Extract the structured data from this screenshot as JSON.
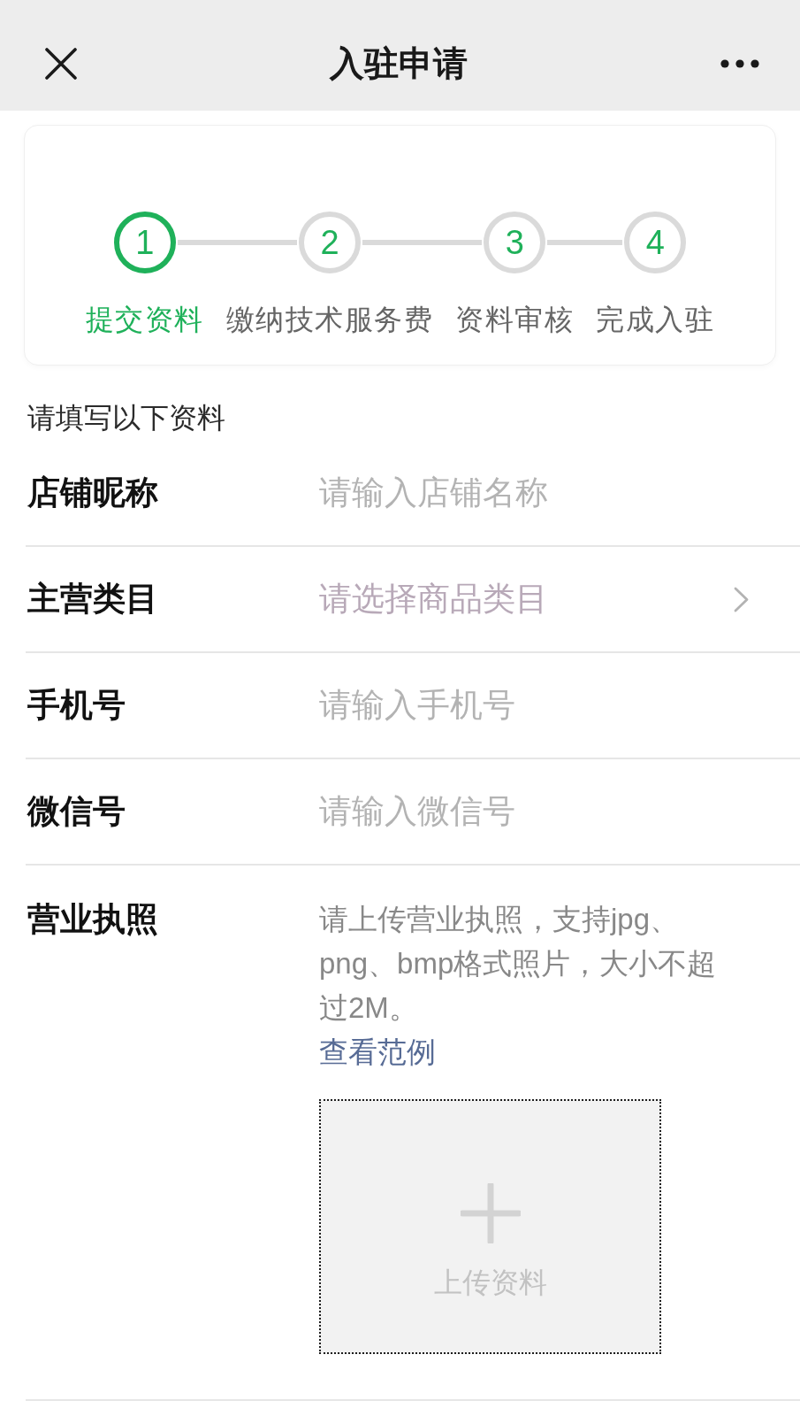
{
  "header": {
    "title": "入驻申请"
  },
  "steps": [
    {
      "number": "1",
      "label": "提交资料",
      "active": true
    },
    {
      "number": "2",
      "label": "缴纳技术服务费",
      "active": false
    },
    {
      "number": "3",
      "label": "资料审核",
      "active": false
    },
    {
      "number": "4",
      "label": "完成入驻",
      "active": false
    }
  ],
  "form": {
    "heading": "请填写以下资料",
    "fields": [
      {
        "kind": "input",
        "label": "店铺昵称",
        "placeholder": "请输入店铺名称"
      },
      {
        "kind": "select",
        "label": "主营类目",
        "placeholder": "请选择商品类目"
      },
      {
        "kind": "input",
        "label": "手机号",
        "placeholder": "请输入手机号"
      },
      {
        "kind": "input",
        "label": "微信号",
        "placeholder": "请输入微信号"
      },
      {
        "kind": "upload",
        "label": "营业执照",
        "description": "请上传营业执照，支持jpg、png、bmp格式照片，大小不超过2M。",
        "link": "查看范例",
        "upload_label": "上传资料"
      }
    ]
  }
}
